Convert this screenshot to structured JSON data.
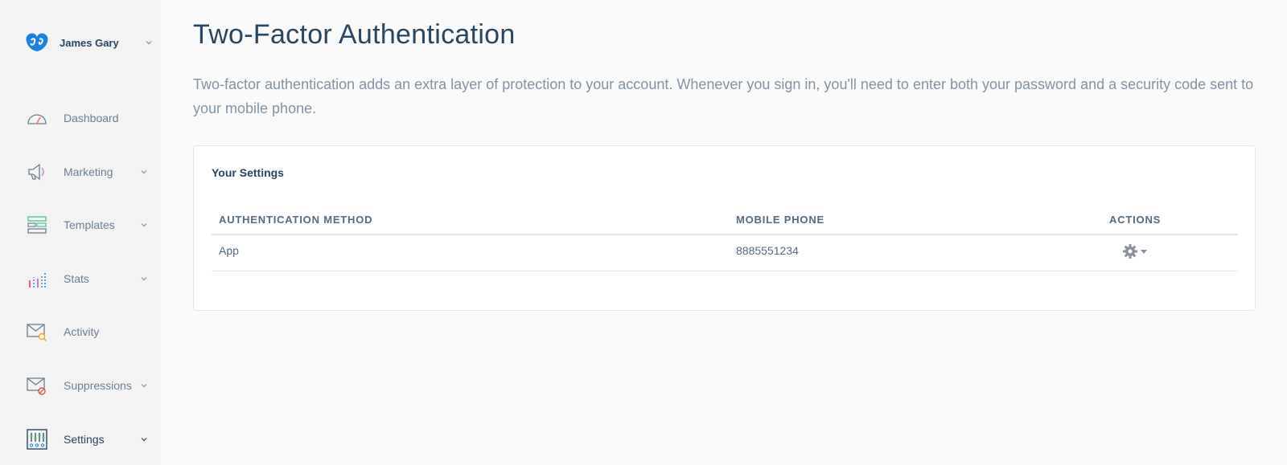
{
  "account": {
    "name": "James Gary",
    "logo_icon": "sendgrid-logo-icon"
  },
  "sidebar": {
    "items": [
      {
        "label": "Dashboard",
        "icon": "speedometer-icon",
        "has_submenu": false
      },
      {
        "label": "Marketing",
        "icon": "megaphone-icon",
        "has_submenu": true
      },
      {
        "label": "Templates",
        "icon": "templates-icon",
        "has_submenu": true
      },
      {
        "label": "Stats",
        "icon": "bar-chart-icon",
        "has_submenu": true
      },
      {
        "label": "Activity",
        "icon": "mail-search-icon",
        "has_submenu": false
      },
      {
        "label": "Suppressions",
        "icon": "mail-blocked-icon",
        "has_submenu": true
      },
      {
        "label": "Settings",
        "icon": "sliders-icon",
        "has_submenu": true,
        "active": true
      }
    ]
  },
  "page": {
    "title": "Two-Factor Authentication",
    "description": "Two-factor authentication adds an extra layer of protection to your account. Whenever you sign in, you'll need to enter both your password and a security code sent to your mobile phone."
  },
  "settings_card": {
    "title": "Your Settings",
    "columns": [
      "Authentication Method",
      "Mobile Phone",
      "Actions"
    ],
    "rows": [
      {
        "method": "App",
        "phone": "8885551234",
        "actions_icon": "gear-icon"
      }
    ]
  },
  "colors": {
    "sidebar_bg": "#f3f3f3",
    "page_bg": "#fafafa",
    "title": "#294661",
    "muted": "#8194a7",
    "accent_blue": "#1a82e2"
  }
}
